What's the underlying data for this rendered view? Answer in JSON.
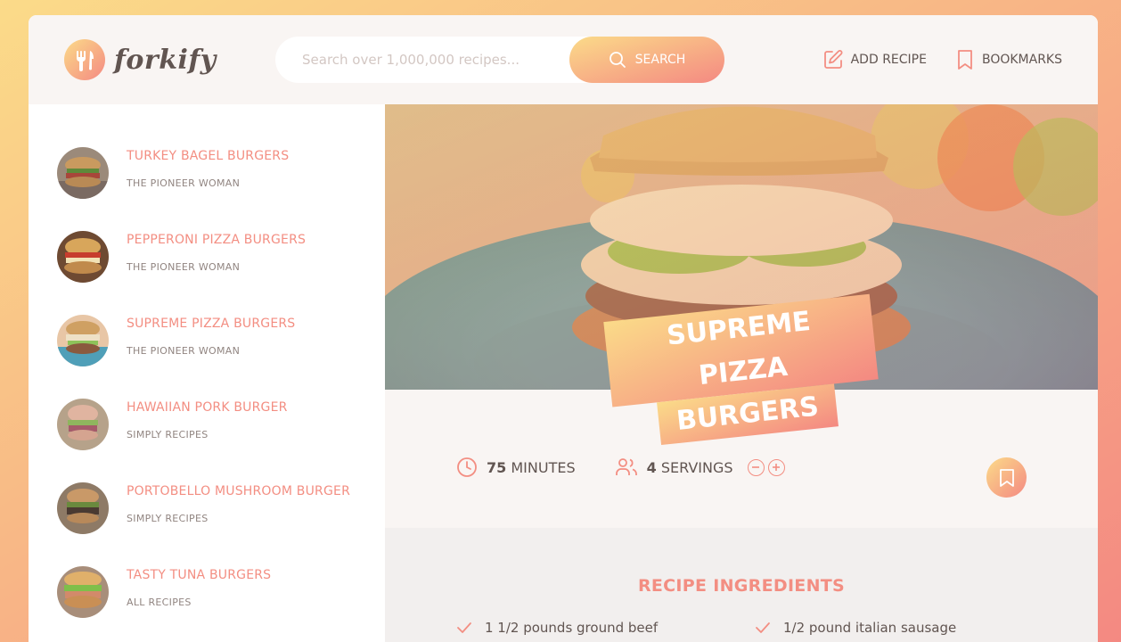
{
  "app": {
    "logo_text": "forkify"
  },
  "search": {
    "placeholder": "Search over 1,000,000 recipes...",
    "button_label": "SEARCH"
  },
  "nav": {
    "add_recipe": "ADD RECIPE",
    "bookmarks": "BOOKMARKS"
  },
  "results": [
    {
      "title": "TURKEY BAGEL BURGERS",
      "publisher": "THE PIONEER WOMAN"
    },
    {
      "title": "PEPPERONI PIZZA BURGERS",
      "publisher": "THE PIONEER WOMAN"
    },
    {
      "title": "SUPREME PIZZA BURGERS",
      "publisher": "THE PIONEER WOMAN"
    },
    {
      "title": "HAWAIIAN PORK BURGER",
      "publisher": "SIMPLY RECIPES"
    },
    {
      "title": "PORTOBELLO MUSHROOM BURGER",
      "publisher": "SIMPLY RECIPES"
    },
    {
      "title": "TASTY TUNA BURGERS",
      "publisher": "ALL RECIPES"
    }
  ],
  "recipe": {
    "title_line1": "SUPREME PIZZA",
    "title_line2": "BURGERS",
    "cooking_time": "75",
    "time_unit": "MINUTES",
    "servings": "4",
    "servings_unit": "SERVINGS",
    "ingredients_heading": "RECIPE INGREDIENTS",
    "ingredients": [
      "1 1/2 pounds ground beef",
      "1/2 pound italian sausage"
    ]
  },
  "colors": {
    "accent": "#f38e82",
    "gradient_start": "#fbdb89",
    "gradient_end": "#f48982",
    "text": "#615551"
  },
  "icons": {
    "logo": "fork-knife-icon",
    "search": "search-icon",
    "add_recipe": "edit-icon",
    "bookmarks": "bookmark-icon",
    "time": "clock-icon",
    "servings": "users-icon",
    "decrease": "minus-circle-icon",
    "increase": "plus-circle-icon",
    "ingredient": "check-icon"
  }
}
